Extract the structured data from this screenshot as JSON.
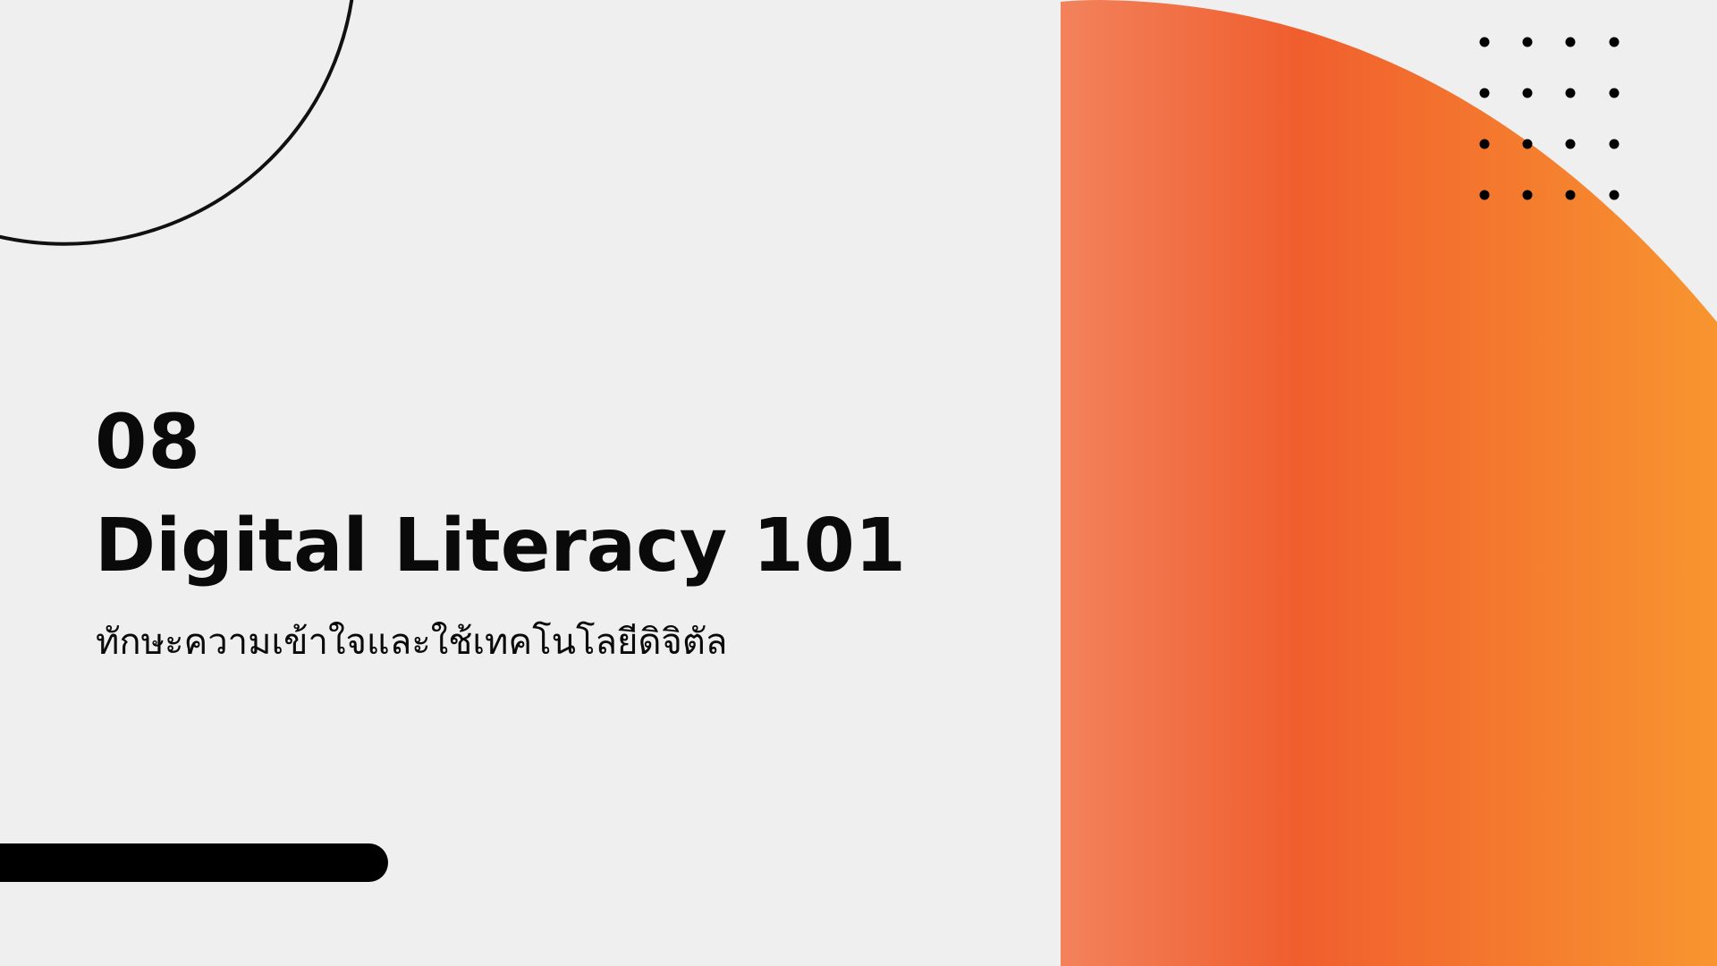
{
  "slide": {
    "number": "08",
    "title": "Digital Literacy 101",
    "subtitle": "ทักษะความเข้าใจและใช้เทคโนโลยีดิจิตัล"
  },
  "colors": {
    "background": "#efefef",
    "text": "#0a0a0a",
    "gradient_start": "#f2825c",
    "gradient_mid": "#f05e2e",
    "gradient_end": "#f8952f",
    "decor": "#000000"
  },
  "decorations": {
    "top_left": "circle-outline-arc",
    "top_right": "dot-grid",
    "bottom_left": "rounded-bar",
    "right": "orange-gradient-quarter-circle"
  }
}
